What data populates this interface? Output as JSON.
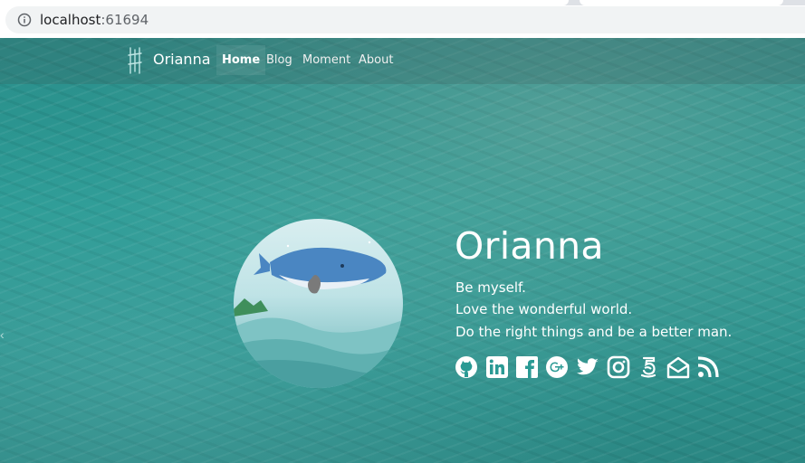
{
  "browser": {
    "url_host": "localhost",
    "url_port": ":61694"
  },
  "navbar": {
    "brand": "Orianna",
    "items": [
      {
        "label": "Home",
        "active": true
      },
      {
        "label": "Blog",
        "active": false
      },
      {
        "label": "Moment",
        "active": false
      },
      {
        "label": "About",
        "active": false
      }
    ]
  },
  "profile": {
    "name": "Orianna",
    "bio": [
      "Be myself.",
      "Love the wonderful world.",
      "Do the right things and be a better man."
    ]
  },
  "social_icons": [
    "github-icon",
    "linkedin-icon",
    "facebook-icon",
    "google-plus-icon",
    "twitter-icon",
    "instagram-icon",
    "five-hundred-px-icon",
    "email-icon",
    "rss-icon"
  ],
  "colors": {
    "sea": "#2a9a94",
    "text": "#ffffff",
    "nav_active_bg": "rgba(255,255,255,0.08)"
  }
}
